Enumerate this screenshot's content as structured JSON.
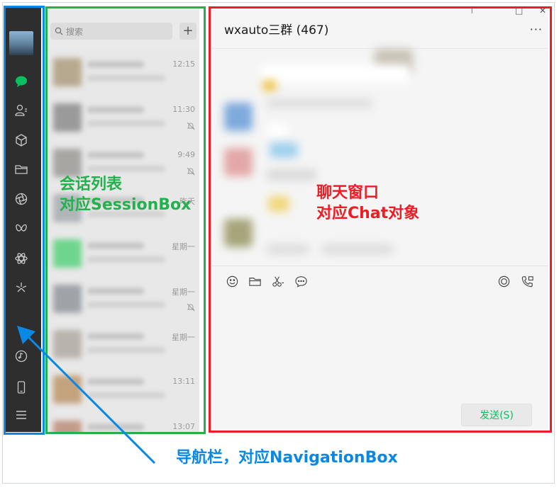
{
  "navigation": {
    "items": [
      {
        "name": "chat-icon"
      },
      {
        "name": "contacts-icon"
      },
      {
        "name": "favorites-icon"
      },
      {
        "name": "files-icon"
      },
      {
        "name": "moments-icon"
      },
      {
        "name": "channels-icon"
      },
      {
        "name": "search-feed-icon"
      },
      {
        "name": "mini-programs-icon"
      },
      {
        "name": "music-icon"
      },
      {
        "name": "phone-icon"
      },
      {
        "name": "menu-icon"
      }
    ]
  },
  "session": {
    "search_placeholder": "搜索",
    "add_label": "+",
    "items": [
      {
        "time": "12:15",
        "muted": false
      },
      {
        "time": "11:30",
        "muted": true
      },
      {
        "time": "9:49",
        "muted": true
      },
      {
        "time": "昨天",
        "muted": false
      },
      {
        "time": "星期一",
        "muted": false
      },
      {
        "time": "星期一",
        "muted": true
      },
      {
        "time": "星期一",
        "muted": false
      },
      {
        "time": "13:11",
        "muted": false
      },
      {
        "time": "13:07",
        "muted": false
      }
    ]
  },
  "chat": {
    "title": "wxauto三群 (467)",
    "more_label": "···",
    "send_label": "发送(S)",
    "tools": [
      "emoji-icon",
      "folder-icon",
      "scissors-icon",
      "chat-history-icon",
      "live-icon",
      "call-icon"
    ]
  },
  "annotations": {
    "session_line1": "会话列表",
    "session_line2": "对应SessionBox",
    "chat_line1": "聊天窗口",
    "chat_line2": "对应Chat对象",
    "nav_label": "导航栏，对应NavigationBox"
  },
  "colors": {
    "nav_bg": "#2e2e2e",
    "accent_green": "#07c160",
    "annotation_blue": "#0b88e3",
    "annotation_green": "#22b14c",
    "annotation_red": "#ee1c24"
  }
}
